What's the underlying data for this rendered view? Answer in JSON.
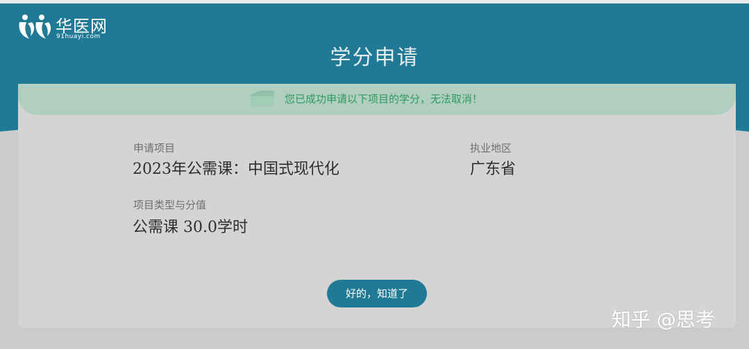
{
  "colors": {
    "header": "#207a96",
    "card": "#d4d4d4",
    "notice_bg": "#b0cfc0",
    "notice_text": "#2f9a5e",
    "button": "#207a96"
  },
  "logo": {
    "name": "华医网",
    "domain": "91huayi.com",
    "icon": "huayi-logo-icon"
  },
  "page_title": "学分申请",
  "notice": {
    "icon": "folder-icon",
    "text": "您已成功申请以下项目的学分，无法取消！"
  },
  "fields": {
    "project": {
      "label": "申请项目",
      "value": "2023年公需课：中国式现代化"
    },
    "region": {
      "label": "执业地区",
      "value": "广东省"
    },
    "type_credit": {
      "label": "项目类型与分值",
      "value": "公需课 30.0学时"
    }
  },
  "ok_button": {
    "label": "好的，知道了"
  },
  "watermark": "知乎 @思考"
}
